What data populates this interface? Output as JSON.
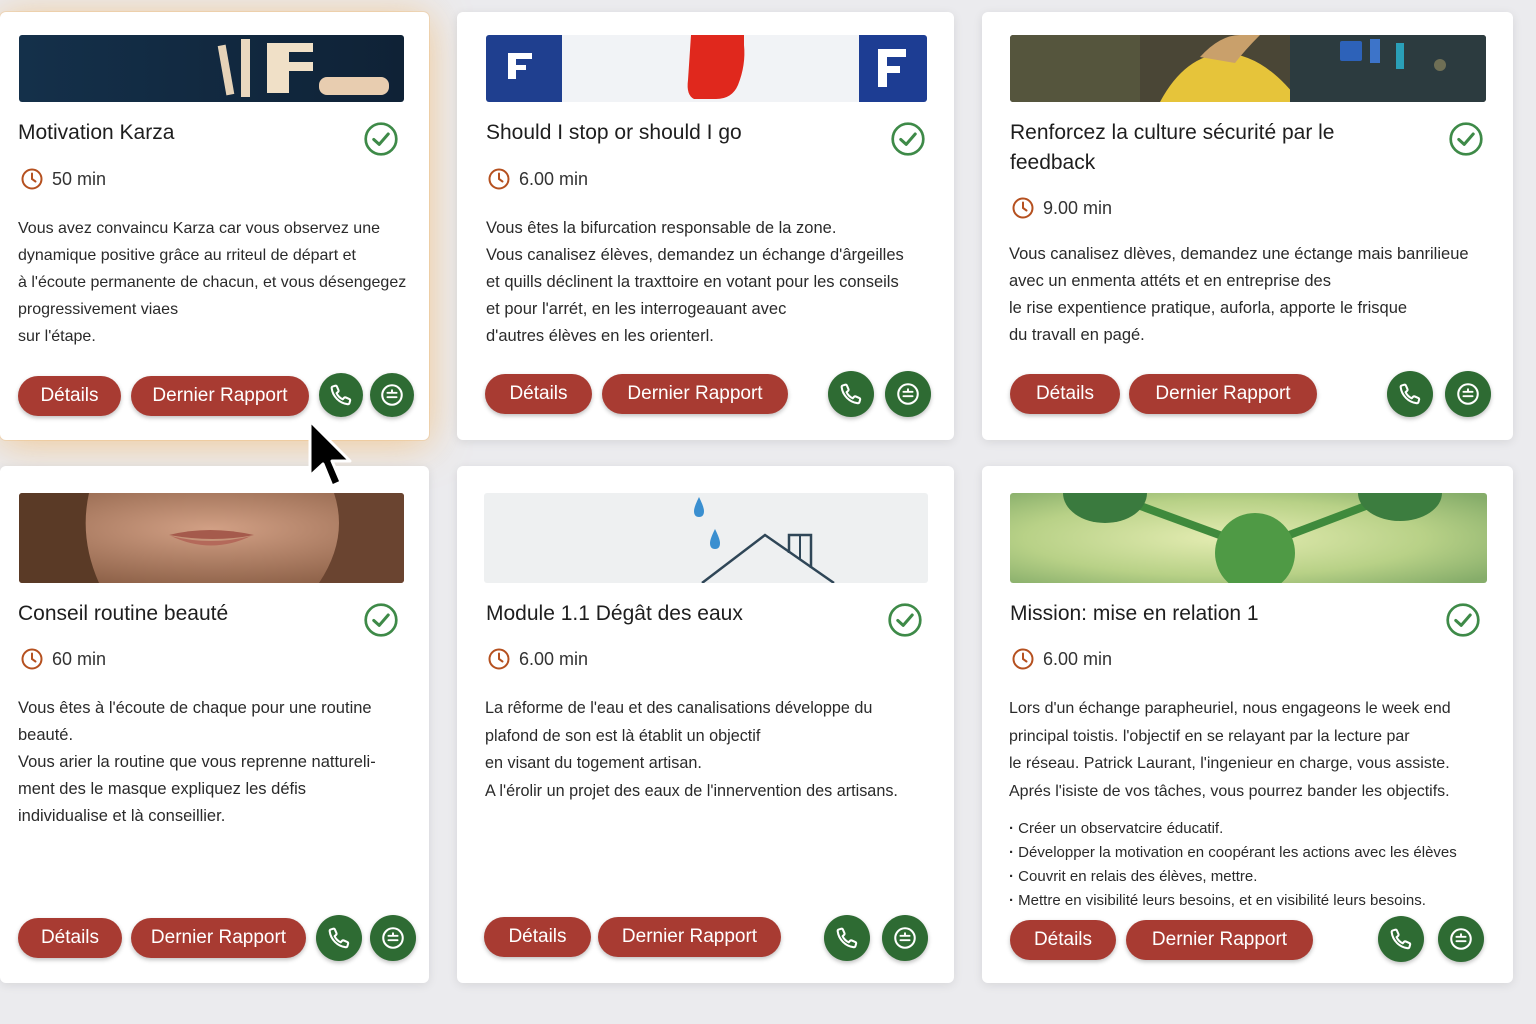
{
  "buttons": {
    "details_label": "Détails",
    "report_label": "Dernier Rapport"
  },
  "colors": {
    "accent_red": "#a83b32",
    "accent_green": "#2e6b33",
    "check_green": "#3e8a48",
    "clock_orange": "#b5501f"
  },
  "icons": [
    "check-circle-icon",
    "clock-icon",
    "phone-icon",
    "chat-icon",
    "mouse-cursor-icon"
  ],
  "cards": [
    {
      "title": "Motivation Karza",
      "duration": "50 min",
      "description": "Vous avez convaincu Karza car vous observez une\ndynamique positive grâce au rriteul de départ et\nà l'écoute permanente de chacun, et vous désengegez\nprogressivement viaes\nsur l'étape."
    },
    {
      "title": "Should I stop or should I go",
      "duration": "6.00 min",
      "description": "Vous êtes la bifurcation responsable de la zone.\nVous canalisez élèves, demandez un échange d'ârgeilles\net quills déclinent la traxttoire en votant pour les conseils\net pour l'arrét, en les interrogeauant avec\nd'autres élèves en les orienterl."
    },
    {
      "title": "Renforcez la culture sécurité par le feedback",
      "duration": "9.00 min",
      "description": "Vous canalisez dlèves, demandez une éctange mais banrilieue\navec un enmenta attéts et en entreprise des\nle rise expentience pratique, auforla, apporte le frisque\ndu travall en pagé."
    },
    {
      "title": "Conseil routine beauté",
      "duration": "60 min",
      "description": "Vous êtes à l'écoute de chaque pour une routine\nbeauté.\nVous arier la routine que vous reprenne nattureli-\nment des le masque expliquez les défis\nindividualise et là conseillier."
    },
    {
      "title": "Module 1.1 Dégât des eaux",
      "duration": "6.00 min",
      "description": "La rêforme de l'eau et des canalisations développe du\nplafond de son est  là établit un objectif\nen visant du togement artisan.\nA l'érolir un projet des eaux de l'innervention des artisans."
    },
    {
      "title": "Mission: mise en relation 1",
      "duration": "6.00 min",
      "description": "Lors d'un échange parapheuriel, nous engageons le week end\nprincipal toistis. l'objectif en se relayant par la lecture par\nle réseau. Patrick Laurant, l'ingenieur en charge, vous assiste.\nAprés l'isiste de vos tâches, vous pourrez bander les objectifs.",
      "bullets": [
        "Créer un observatcire éducatif.",
        "Développer la motivation en coopérant les actions avec les élèves",
        "Couvrit en relais des élèves, mettre.",
        "Mettre en visibilité leurs besoins, et en visibilité leurs besoins."
      ]
    }
  ]
}
